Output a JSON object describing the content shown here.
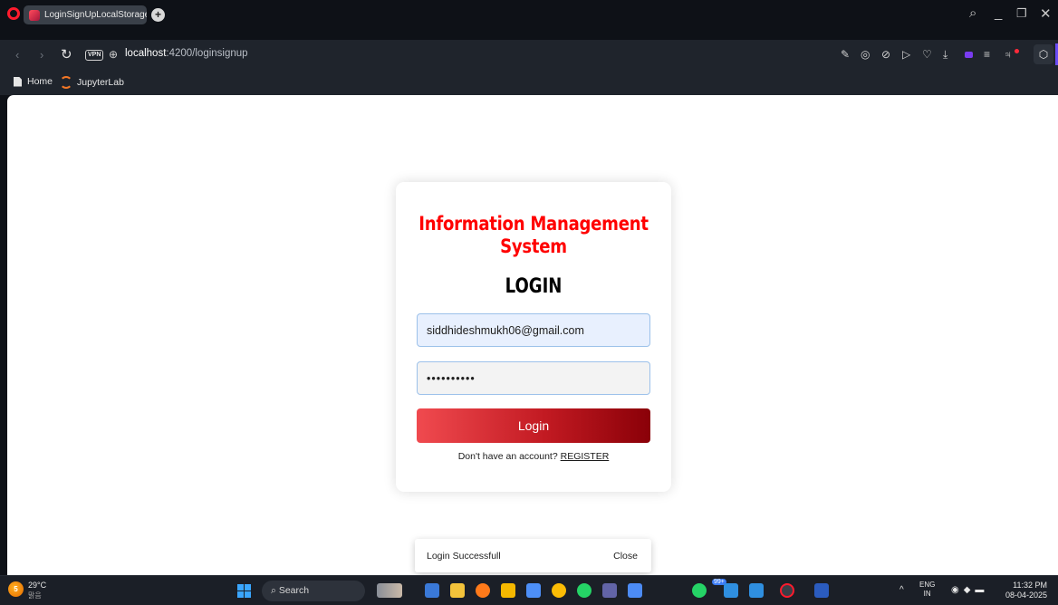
{
  "browser": {
    "tab_title": "LoginSignUpLocalStorage",
    "newtab_glyph": "+",
    "url_host": "localhost",
    "url_path": ":4200/loginsignup",
    "vpn_label": "VPN"
  },
  "bookmarks": [
    {
      "label": "Home"
    },
    {
      "label": "JupyterLab"
    }
  ],
  "page": {
    "brand_title": "Information Management System",
    "form_title": "LOGIN",
    "email_value": "siddhideshmukh06@gmail.com",
    "password_value": "••••••••••",
    "login_button": "Login",
    "register_prompt": "Don't have an account?",
    "register_link": "REGISTER"
  },
  "snackbar": {
    "message": "Login Successfull",
    "action": "Close"
  },
  "taskbar": {
    "weather_badge": "5",
    "temperature": "29°C",
    "condition": "맑음",
    "search_label": "Search",
    "badge_count": "99+",
    "lang_top": "ENG",
    "lang_bottom": "IN",
    "time": "11:32 PM",
    "date": "08-04-2025"
  },
  "colors": {
    "brand_red": "#ff0000",
    "button_start": "#f04a4f",
    "button_end": "#8a0008",
    "field_border": "#9cc1ea"
  }
}
